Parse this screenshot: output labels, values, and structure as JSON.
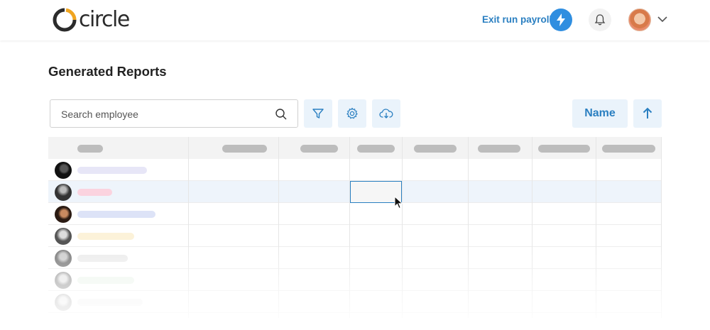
{
  "header": {
    "logo_text": "circle",
    "exit_label": "Exit run payroll",
    "icons": {
      "bolt": "bolt-icon",
      "bell": "bell-icon",
      "chevron": "chevron-down-icon"
    },
    "accent_color": "#2a7fc1"
  },
  "page": {
    "title": "Generated Reports"
  },
  "toolbar": {
    "search_placeholder": "Search employee",
    "sort_label": "Name",
    "icons": [
      "filter-icon",
      "gear-icon",
      "cloud-download-icon",
      "arrow-up-icon"
    ]
  },
  "table": {
    "row_placeholder_colors": [
      "#e7e6f7",
      "#fbd3df",
      "#dde3f7",
      "#fcf2d9",
      "#ececec",
      "#eef6ee",
      "#f3f3f3"
    ],
    "selected_row": 1,
    "selected_column": 3
  }
}
